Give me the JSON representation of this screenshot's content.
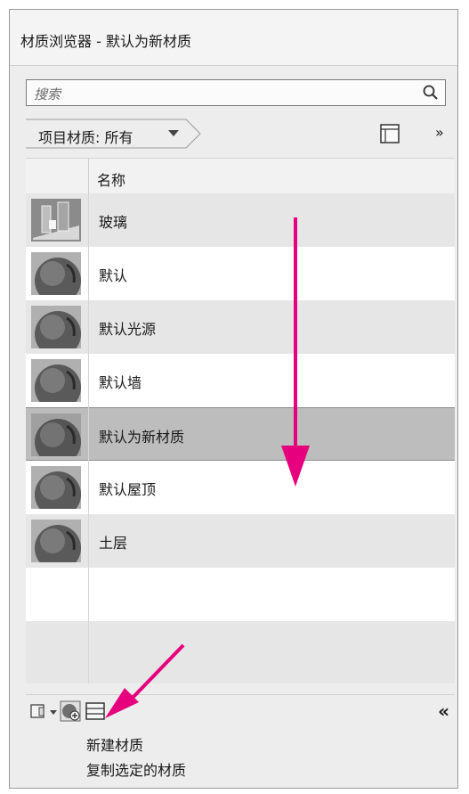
{
  "window": {
    "title": "材质浏览器 - 默认为新材质"
  },
  "search": {
    "placeholder": "搜索"
  },
  "filter": {
    "breadcrumb": "项目材质: 所有",
    "more_label": "»"
  },
  "list": {
    "column_header": "名称",
    "items": [
      {
        "name": "玻璃",
        "thumb": "glass-thumbnail"
      },
      {
        "name": "默认",
        "thumb": "sphere-thumbnail"
      },
      {
        "name": "默认光源",
        "thumb": "sphere-thumbnail"
      },
      {
        "name": "默认墙",
        "thumb": "sphere-thumbnail"
      },
      {
        "name": "默认为新材质",
        "thumb": "sphere-thumbnail",
        "selected": true
      },
      {
        "name": "默认屋顶",
        "thumb": "sphere-thumbnail"
      },
      {
        "name": "土层",
        "thumb": "sphere-thumbnail"
      }
    ]
  },
  "toolbar": {
    "collapse_label": "«"
  },
  "menu": {
    "items": [
      "新建材质",
      "复制选定的材质"
    ]
  },
  "colors": {
    "annotation_arrow": "#e6007e",
    "selected_row": "#bdbdbd"
  }
}
